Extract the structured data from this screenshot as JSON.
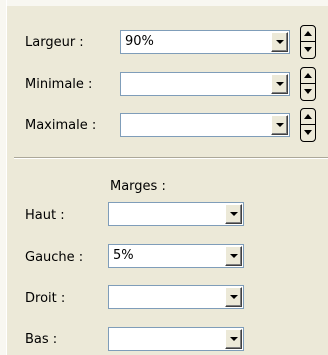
{
  "size": {
    "width_label": "Largeur :",
    "width_value": "90%",
    "min_label": "Minimale :",
    "min_value": "",
    "max_label": "Maximale :",
    "max_value": ""
  },
  "margins": {
    "heading": "Marges :",
    "top_label": "Haut :",
    "top_value": "",
    "left_label": "Gauche :",
    "left_value": "5%",
    "right_label": "Droit :",
    "right_value": "",
    "bottom_label": "Bas :",
    "bottom_value": ""
  },
  "icons": {
    "dropdown": "chevron-down-icon",
    "spin_up": "arrow-up-icon",
    "spin_down": "arrow-down-icon"
  }
}
